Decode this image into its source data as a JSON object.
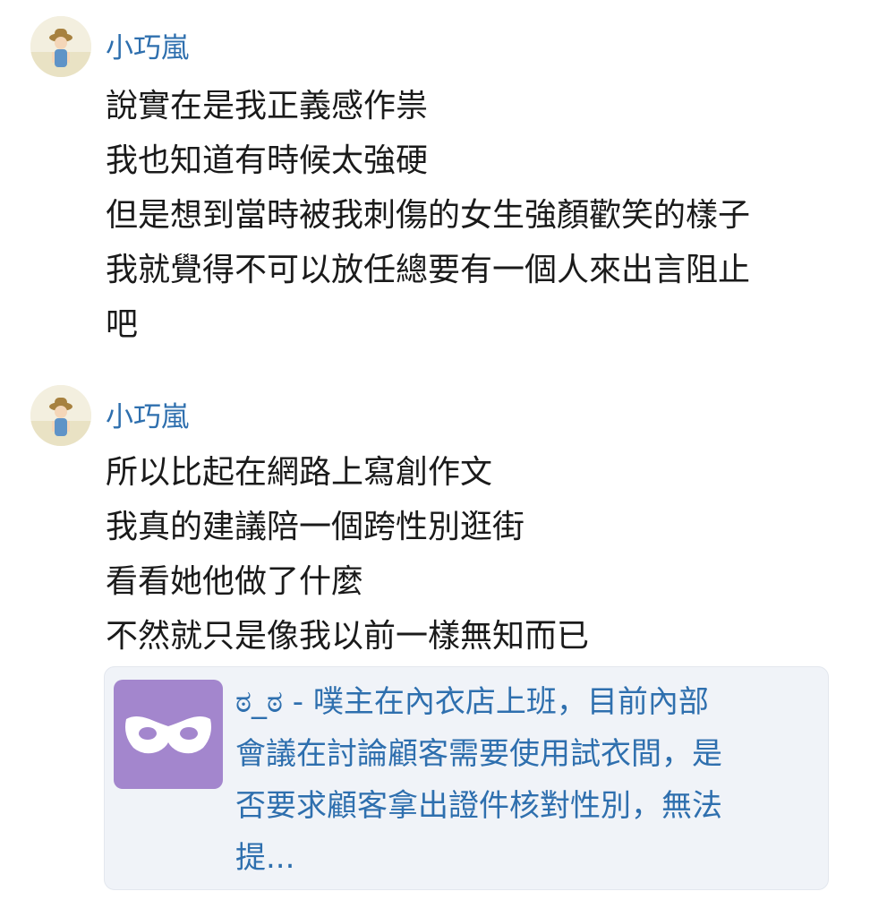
{
  "posts": [
    {
      "username": "小巧嵐",
      "lines": [
        "說實在是我正義感作祟",
        "我也知道有時候太強硬",
        "但是想到當時被我刺傷的女生強顏歡笑的樣子",
        "我就覺得不可以放任總要有一個人來出言阻止",
        "吧"
      ]
    },
    {
      "username": "小巧嵐",
      "lines": [
        "所以比起在網路上寫創作文",
        "我真的建議陪一個跨性別逛街",
        "看看她他做了什麼",
        "不然就只是像我以前一樣無知而已"
      ]
    }
  ],
  "link_card": {
    "thumbnail_icon": "mask-icon",
    "thumbnail_color": "#a386cd",
    "lines": [
      "ಠ_ಠ - 噗主在內衣店上班，目前內部",
      "會議在討論顧客需要使用試衣間，是",
      "否要求顧客拿出證件核對性別，無法",
      "提..."
    ]
  },
  "colors": {
    "username": "#2e6fae",
    "body_text": "#1a1a1a",
    "card_text": "#2e6fae",
    "card_background": "#f0f3f8"
  }
}
